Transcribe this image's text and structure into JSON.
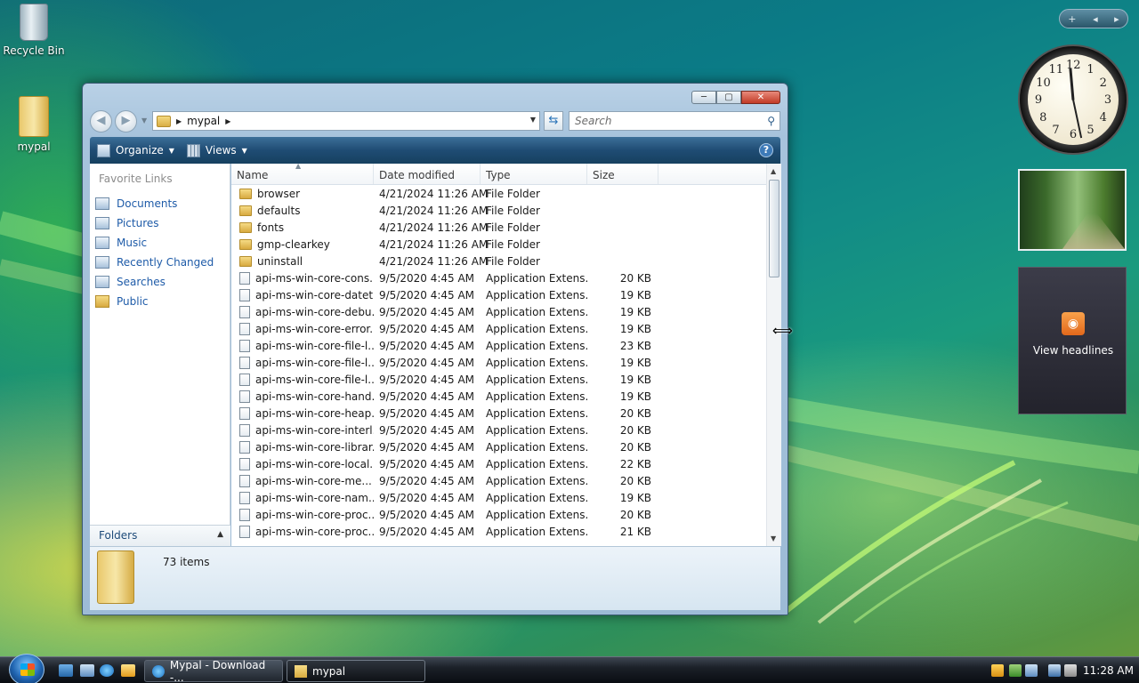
{
  "desktop": {
    "icons": [
      {
        "label": "Recycle Bin"
      },
      {
        "label": "mypal"
      }
    ]
  },
  "explorer": {
    "title_buttons": {
      "minimize": "─",
      "maximize": "▢",
      "close": "✕"
    },
    "address": {
      "crumb_folder": "mypal"
    },
    "search": {
      "placeholder": "Search"
    },
    "toolbar": {
      "organize": "Organize",
      "views": "Views",
      "help": "?"
    },
    "nav": {
      "title": "Favorite Links",
      "links": [
        {
          "label": "Documents",
          "icon": "documents-icon"
        },
        {
          "label": "Pictures",
          "icon": "pictures-icon"
        },
        {
          "label": "Music",
          "icon": "music-icon"
        },
        {
          "label": "Recently Changed",
          "icon": "recently-changed-icon"
        },
        {
          "label": "Searches",
          "icon": "searches-icon"
        },
        {
          "label": "Public",
          "icon": "folder-icon"
        }
      ],
      "folders_label": "Folders"
    },
    "columns": {
      "name": "Name",
      "date": "Date modified",
      "type": "Type",
      "size": "Size"
    },
    "rows": [
      {
        "name": "browser",
        "date": "4/21/2024 11:26 AM",
        "type": "File Folder",
        "size": "",
        "kind": "folder"
      },
      {
        "name": "defaults",
        "date": "4/21/2024 11:26 AM",
        "type": "File Folder",
        "size": "",
        "kind": "folder"
      },
      {
        "name": "fonts",
        "date": "4/21/2024 11:26 AM",
        "type": "File Folder",
        "size": "",
        "kind": "folder"
      },
      {
        "name": "gmp-clearkey",
        "date": "4/21/2024 11:26 AM",
        "type": "File Folder",
        "size": "",
        "kind": "folder"
      },
      {
        "name": "uninstall",
        "date": "4/21/2024 11:26 AM",
        "type": "File Folder",
        "size": "",
        "kind": "folder"
      },
      {
        "name": "api-ms-win-core-cons...",
        "date": "9/5/2020 4:45 AM",
        "type": "Application Extens...",
        "size": "20 KB",
        "kind": "file"
      },
      {
        "name": "api-ms-win-core-datet...",
        "date": "9/5/2020 4:45 AM",
        "type": "Application Extens...",
        "size": "19 KB",
        "kind": "file"
      },
      {
        "name": "api-ms-win-core-debu...",
        "date": "9/5/2020 4:45 AM",
        "type": "Application Extens...",
        "size": "19 KB",
        "kind": "file"
      },
      {
        "name": "api-ms-win-core-error...",
        "date": "9/5/2020 4:45 AM",
        "type": "Application Extens...",
        "size": "19 KB",
        "kind": "file"
      },
      {
        "name": "api-ms-win-core-file-l...",
        "date": "9/5/2020 4:45 AM",
        "type": "Application Extens...",
        "size": "23 KB",
        "kind": "file"
      },
      {
        "name": "api-ms-win-core-file-l...",
        "date": "9/5/2020 4:45 AM",
        "type": "Application Extens...",
        "size": "19 KB",
        "kind": "file"
      },
      {
        "name": "api-ms-win-core-file-l...",
        "date": "9/5/2020 4:45 AM",
        "type": "Application Extens...",
        "size": "19 KB",
        "kind": "file"
      },
      {
        "name": "api-ms-win-core-hand...",
        "date": "9/5/2020 4:45 AM",
        "type": "Application Extens...",
        "size": "19 KB",
        "kind": "file"
      },
      {
        "name": "api-ms-win-core-heap...",
        "date": "9/5/2020 4:45 AM",
        "type": "Application Extens...",
        "size": "20 KB",
        "kind": "file"
      },
      {
        "name": "api-ms-win-core-interl...",
        "date": "9/5/2020 4:45 AM",
        "type": "Application Extens...",
        "size": "20 KB",
        "kind": "file"
      },
      {
        "name": "api-ms-win-core-librar...",
        "date": "9/5/2020 4:45 AM",
        "type": "Application Extens...",
        "size": "20 KB",
        "kind": "file"
      },
      {
        "name": "api-ms-win-core-local...",
        "date": "9/5/2020 4:45 AM",
        "type": "Application Extens...",
        "size": "22 KB",
        "kind": "file"
      },
      {
        "name": "api-ms-win-core-me...",
        "date": "9/5/2020 4:45 AM",
        "type": "Application Extens...",
        "size": "20 KB",
        "kind": "file"
      },
      {
        "name": "api-ms-win-core-nam...",
        "date": "9/5/2020 4:45 AM",
        "type": "Application Extens...",
        "size": "19 KB",
        "kind": "file"
      },
      {
        "name": "api-ms-win-core-proc...",
        "date": "9/5/2020 4:45 AM",
        "type": "Application Extens...",
        "size": "20 KB",
        "kind": "file"
      },
      {
        "name": "api-ms-win-core-proc...",
        "date": "9/5/2020 4:45 AM",
        "type": "Application Extens...",
        "size": "21 KB",
        "kind": "file"
      }
    ],
    "details": {
      "item_count": "73 items"
    }
  },
  "gadgets": {
    "control": {
      "add": "+",
      "prev": "◂",
      "next": "▸"
    },
    "clock": {
      "numbers": [
        "12",
        "1",
        "2",
        "3",
        "4",
        "5",
        "6",
        "7",
        "8",
        "9",
        "10",
        "11"
      ]
    },
    "feed": {
      "label": "View headlines"
    }
  },
  "taskbar": {
    "tasks": [
      {
        "label": "Mypal - Download -...",
        "icon": "ie-icon"
      },
      {
        "label": "mypal",
        "icon": "folder-icon"
      }
    ],
    "time": "11:28 AM"
  },
  "colors": {
    "link": "#1e5ba8",
    "toolbar": "#1f4c74",
    "folder": "#e3bf5a"
  }
}
